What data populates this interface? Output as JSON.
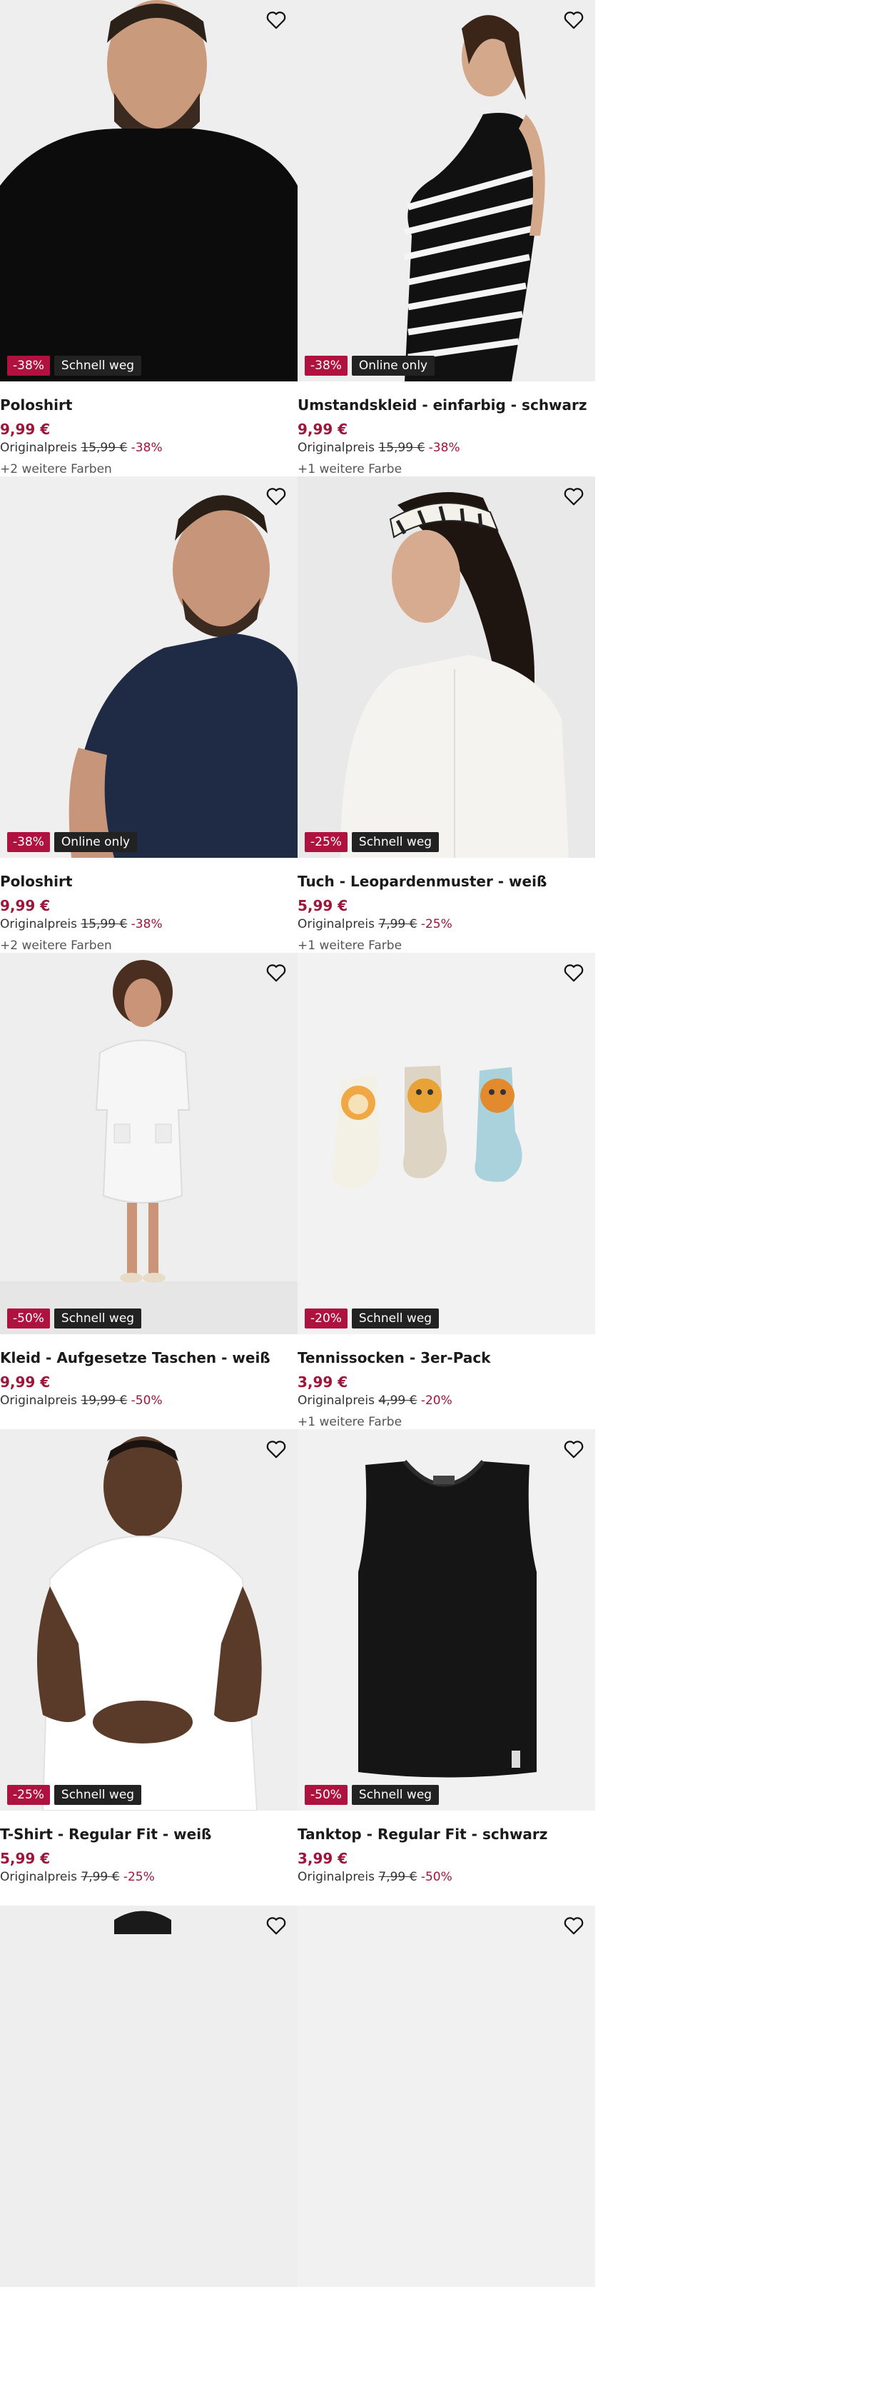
{
  "products": [
    {
      "name": "Poloshirt",
      "price": "9,99 €",
      "orig_label": "Originalpreis",
      "orig_price": "15,99 €",
      "orig_discount": "-38%",
      "badge_discount": "-38%",
      "badge_tag": "Schnell weg",
      "colors": "+2 weitere Farben"
    },
    {
      "name": "Umstandskleid - einfarbig - schwarz",
      "price": "9,99 €",
      "orig_label": "Originalpreis",
      "orig_price": "15,99 €",
      "orig_discount": "-38%",
      "badge_discount": "-38%",
      "badge_tag": "Online only",
      "colors": "+1 weitere Farbe"
    },
    {
      "name": "Poloshirt",
      "price": "9,99 €",
      "orig_label": "Originalpreis",
      "orig_price": "15,99 €",
      "orig_discount": "-38%",
      "badge_discount": "-38%",
      "badge_tag": "Online only",
      "colors": "+2 weitere Farben"
    },
    {
      "name": "Tuch - Leopardenmuster - weiß",
      "price": "5,99 €",
      "orig_label": "Originalpreis",
      "orig_price": "7,99 €",
      "orig_discount": "-25%",
      "badge_discount": "-25%",
      "badge_tag": "Schnell weg",
      "colors": "+1 weitere Farbe"
    },
    {
      "name": "Kleid - Aufgesetze Taschen - weiß",
      "price": "9,99 €",
      "orig_label": "Originalpreis",
      "orig_price": "19,99 €",
      "orig_discount": "-50%",
      "badge_discount": "-50%",
      "badge_tag": "Schnell weg",
      "colors": ""
    },
    {
      "name": "Tennissocken - 3er-Pack",
      "price": "3,99 €",
      "orig_label": "Originalpreis",
      "orig_price": "4,99 €",
      "orig_discount": "-20%",
      "badge_discount": "-20%",
      "badge_tag": "Schnell weg",
      "colors": "+1 weitere Farbe"
    },
    {
      "name": "T-Shirt - Regular Fit - weiß",
      "price": "5,99 €",
      "orig_label": "Originalpreis",
      "orig_price": "7,99 €",
      "orig_discount": "-25%",
      "badge_discount": "-25%",
      "badge_tag": "Schnell weg",
      "colors": ""
    },
    {
      "name": "Tanktop - Regular Fit - schwarz",
      "price": "3,99 €",
      "orig_label": "Originalpreis",
      "orig_price": "7,99 €",
      "orig_discount": "-50%",
      "badge_discount": "-50%",
      "badge_tag": "Schnell weg",
      "colors": ""
    }
  ],
  "icons": {
    "favorite": "heart-outline-icon"
  },
  "colors": {
    "price_accent": "#9c1739",
    "badge_discount": "#b0123f",
    "badge_tag": "#222222",
    "image_bg": "#f1f1f1"
  }
}
